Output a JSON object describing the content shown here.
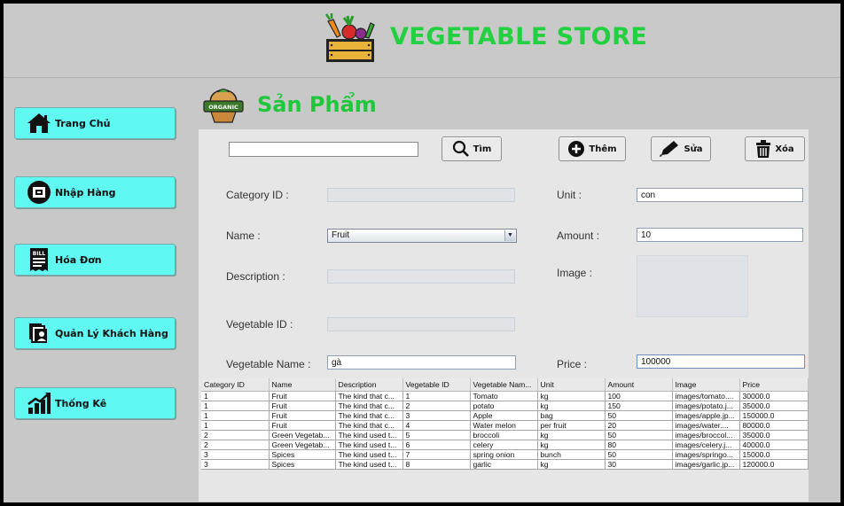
{
  "app": {
    "title": "VEGETABLE  STORE",
    "accent": "#22d040",
    "nav_color": "#5ff9f2"
  },
  "sidebar": {
    "items": [
      {
        "label": "Trang Chủ",
        "icon": "home-icon"
      },
      {
        "label": "Nhập Hàng",
        "icon": "import-icon"
      },
      {
        "label": "Hóa Đơn",
        "icon": "bill-icon"
      },
      {
        "label": "Quản Lý Khách Hàng",
        "icon": "customers-icon"
      },
      {
        "label": "Thống Kê",
        "icon": "chart-icon"
      }
    ]
  },
  "main": {
    "title": "Sản Phẩm",
    "organic_badge": "ORGANIC",
    "bill_badge": "BILL",
    "search": {
      "value": "",
      "button": "Tìm"
    },
    "actions": {
      "add": "Thêm",
      "edit": "Sửa",
      "delete": "Xóa"
    },
    "form": {
      "category_id_label": "Category ID :",
      "category_id_value": "",
      "name_label": "Name :",
      "name_value": "Fruit",
      "description_label": "Description :",
      "description_value": "",
      "vegetable_id_label": "Vegetable ID :",
      "vegetable_id_value": "",
      "vegetable_name_label": "Vegetable Name :",
      "vegetable_name_value": "gà",
      "unit_label": "Unit :",
      "unit_value": "con",
      "amount_label": "Amount :",
      "amount_value": "10",
      "image_label": "Image :",
      "price_label": "Price :",
      "price_value": "100000"
    },
    "table": {
      "columns": [
        "Category ID",
        "Name",
        "Description",
        "Vegetable ID",
        "Vegetable Nam...",
        "Unit",
        "Amount",
        "Image",
        "Price"
      ],
      "rows": [
        [
          "1",
          "Fruit",
          "The kind that c...",
          "1",
          "Tomato",
          "kg",
          "100",
          "images/tomato....",
          "30000.0"
        ],
        [
          "1",
          "Fruit",
          "The kind that c...",
          "2",
          "potato",
          "kg",
          "150",
          "images/potato.j...",
          "35000.0"
        ],
        [
          "1",
          "Fruit",
          "The kind that c...",
          "3",
          "Apple",
          "bag",
          "50",
          "images/apple.jp...",
          "150000.0"
        ],
        [
          "1",
          "Fruit",
          "The kind that c...",
          "4",
          "Water melon",
          "per fruit",
          "20",
          "images/water....",
          "80000.0"
        ],
        [
          "2",
          "Green Vegetab...",
          "The kind used t...",
          "5",
          " broccoli",
          "kg",
          "50",
          "images/broccol...",
          "35000.0"
        ],
        [
          "2",
          "Green Vegetab...",
          "The kind used t...",
          "6",
          "celery",
          "kg",
          "80",
          "images/celery.j...",
          "40000.0"
        ],
        [
          "3",
          "Spices",
          "The kind used t...",
          "7",
          " spring onion",
          "bunch",
          "50",
          "images/springo...",
          "15000.0"
        ],
        [
          "3",
          "Spices",
          "The kind used t...",
          "8",
          "garlic",
          "kg",
          "30",
          "images/garlic.jp...",
          "120000.0"
        ]
      ]
    }
  }
}
